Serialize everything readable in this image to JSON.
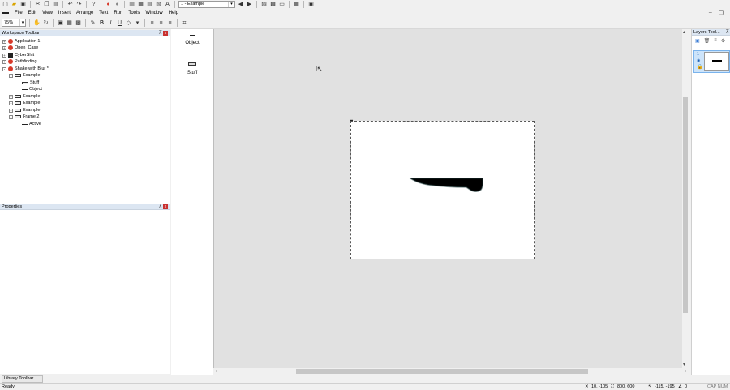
{
  "toolbar": {
    "frame_select": "1 - Example"
  },
  "menu": [
    "File",
    "Edit",
    "View",
    "Insert",
    "Arrange",
    "Text",
    "Run",
    "Tools",
    "Window",
    "Help"
  ],
  "zoom": "75%",
  "workspace": {
    "title": "Workspace Toolbar",
    "tree": [
      {
        "label": "Application 1"
      },
      {
        "label": "Open_Case"
      },
      {
        "label": "CyberShit"
      },
      {
        "label": "Pathfinding"
      },
      {
        "label": "Shake with Blur *"
      },
      {
        "label": "Example"
      },
      {
        "label": "Stuff"
      },
      {
        "label": "Object"
      },
      {
        "label": "Example"
      },
      {
        "label": "Example"
      },
      {
        "label": "Example"
      },
      {
        "label": "Frame 2"
      },
      {
        "label": "Active"
      }
    ]
  },
  "properties": {
    "title": "Properties"
  },
  "library": {
    "items": [
      {
        "label": "Object"
      },
      {
        "label": "Stuff"
      }
    ],
    "tab_label": "Library Toolbar"
  },
  "layers": {
    "title": "Layers Tool...",
    "layer_number": "1"
  },
  "status": {
    "left": "Ready",
    "coords": "10, -105",
    "size": "800, 600",
    "pos": "-115, -195",
    "angle": "0",
    "caps": "CAP NUM"
  },
  "colors": {
    "accent": "#d73a2a",
    "selection": "#cde4fa",
    "panel_title": "#dce6f2"
  }
}
